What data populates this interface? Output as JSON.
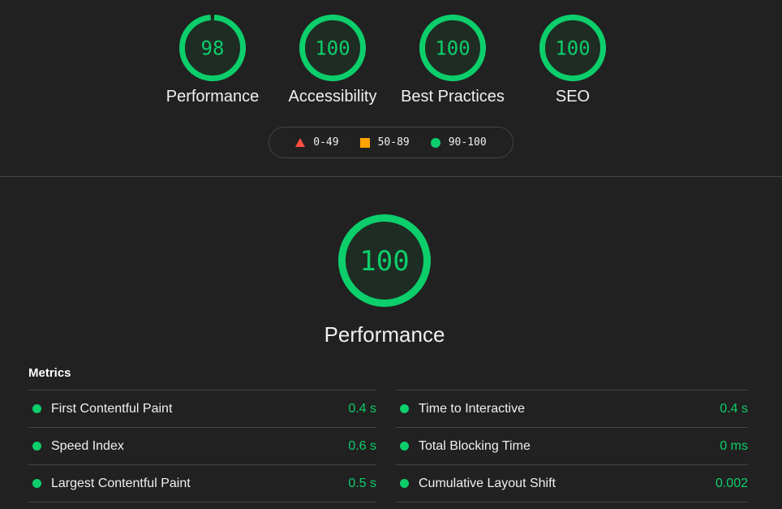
{
  "colors": {
    "pass": "#0cce6b",
    "average": "#ffa400",
    "fail": "#ff4e42",
    "gauge_fill": "#1e2c23",
    "background": "#212121"
  },
  "categories": [
    {
      "label": "Performance",
      "score": 98
    },
    {
      "label": "Accessibility",
      "score": 100
    },
    {
      "label": "Best Practices",
      "score": 100
    },
    {
      "label": "SEO",
      "score": 100
    }
  ],
  "legend": [
    {
      "icon": "triangle-icon",
      "range": "0-49"
    },
    {
      "icon": "square-icon",
      "range": "50-89"
    },
    {
      "icon": "circle-icon",
      "range": "90-100"
    }
  ],
  "main": {
    "score": 100,
    "title": "Performance"
  },
  "metrics": {
    "heading": "Metrics",
    "left": [
      {
        "name": "First Contentful Paint",
        "value": "0.4 s"
      },
      {
        "name": "Speed Index",
        "value": "0.6 s"
      },
      {
        "name": "Largest Contentful Paint",
        "value": "0.5 s"
      }
    ],
    "right": [
      {
        "name": "Time to Interactive",
        "value": "0.4 s"
      },
      {
        "name": "Total Blocking Time",
        "value": "0 ms"
      },
      {
        "name": "Cumulative Layout Shift",
        "value": "0.002"
      }
    ]
  }
}
